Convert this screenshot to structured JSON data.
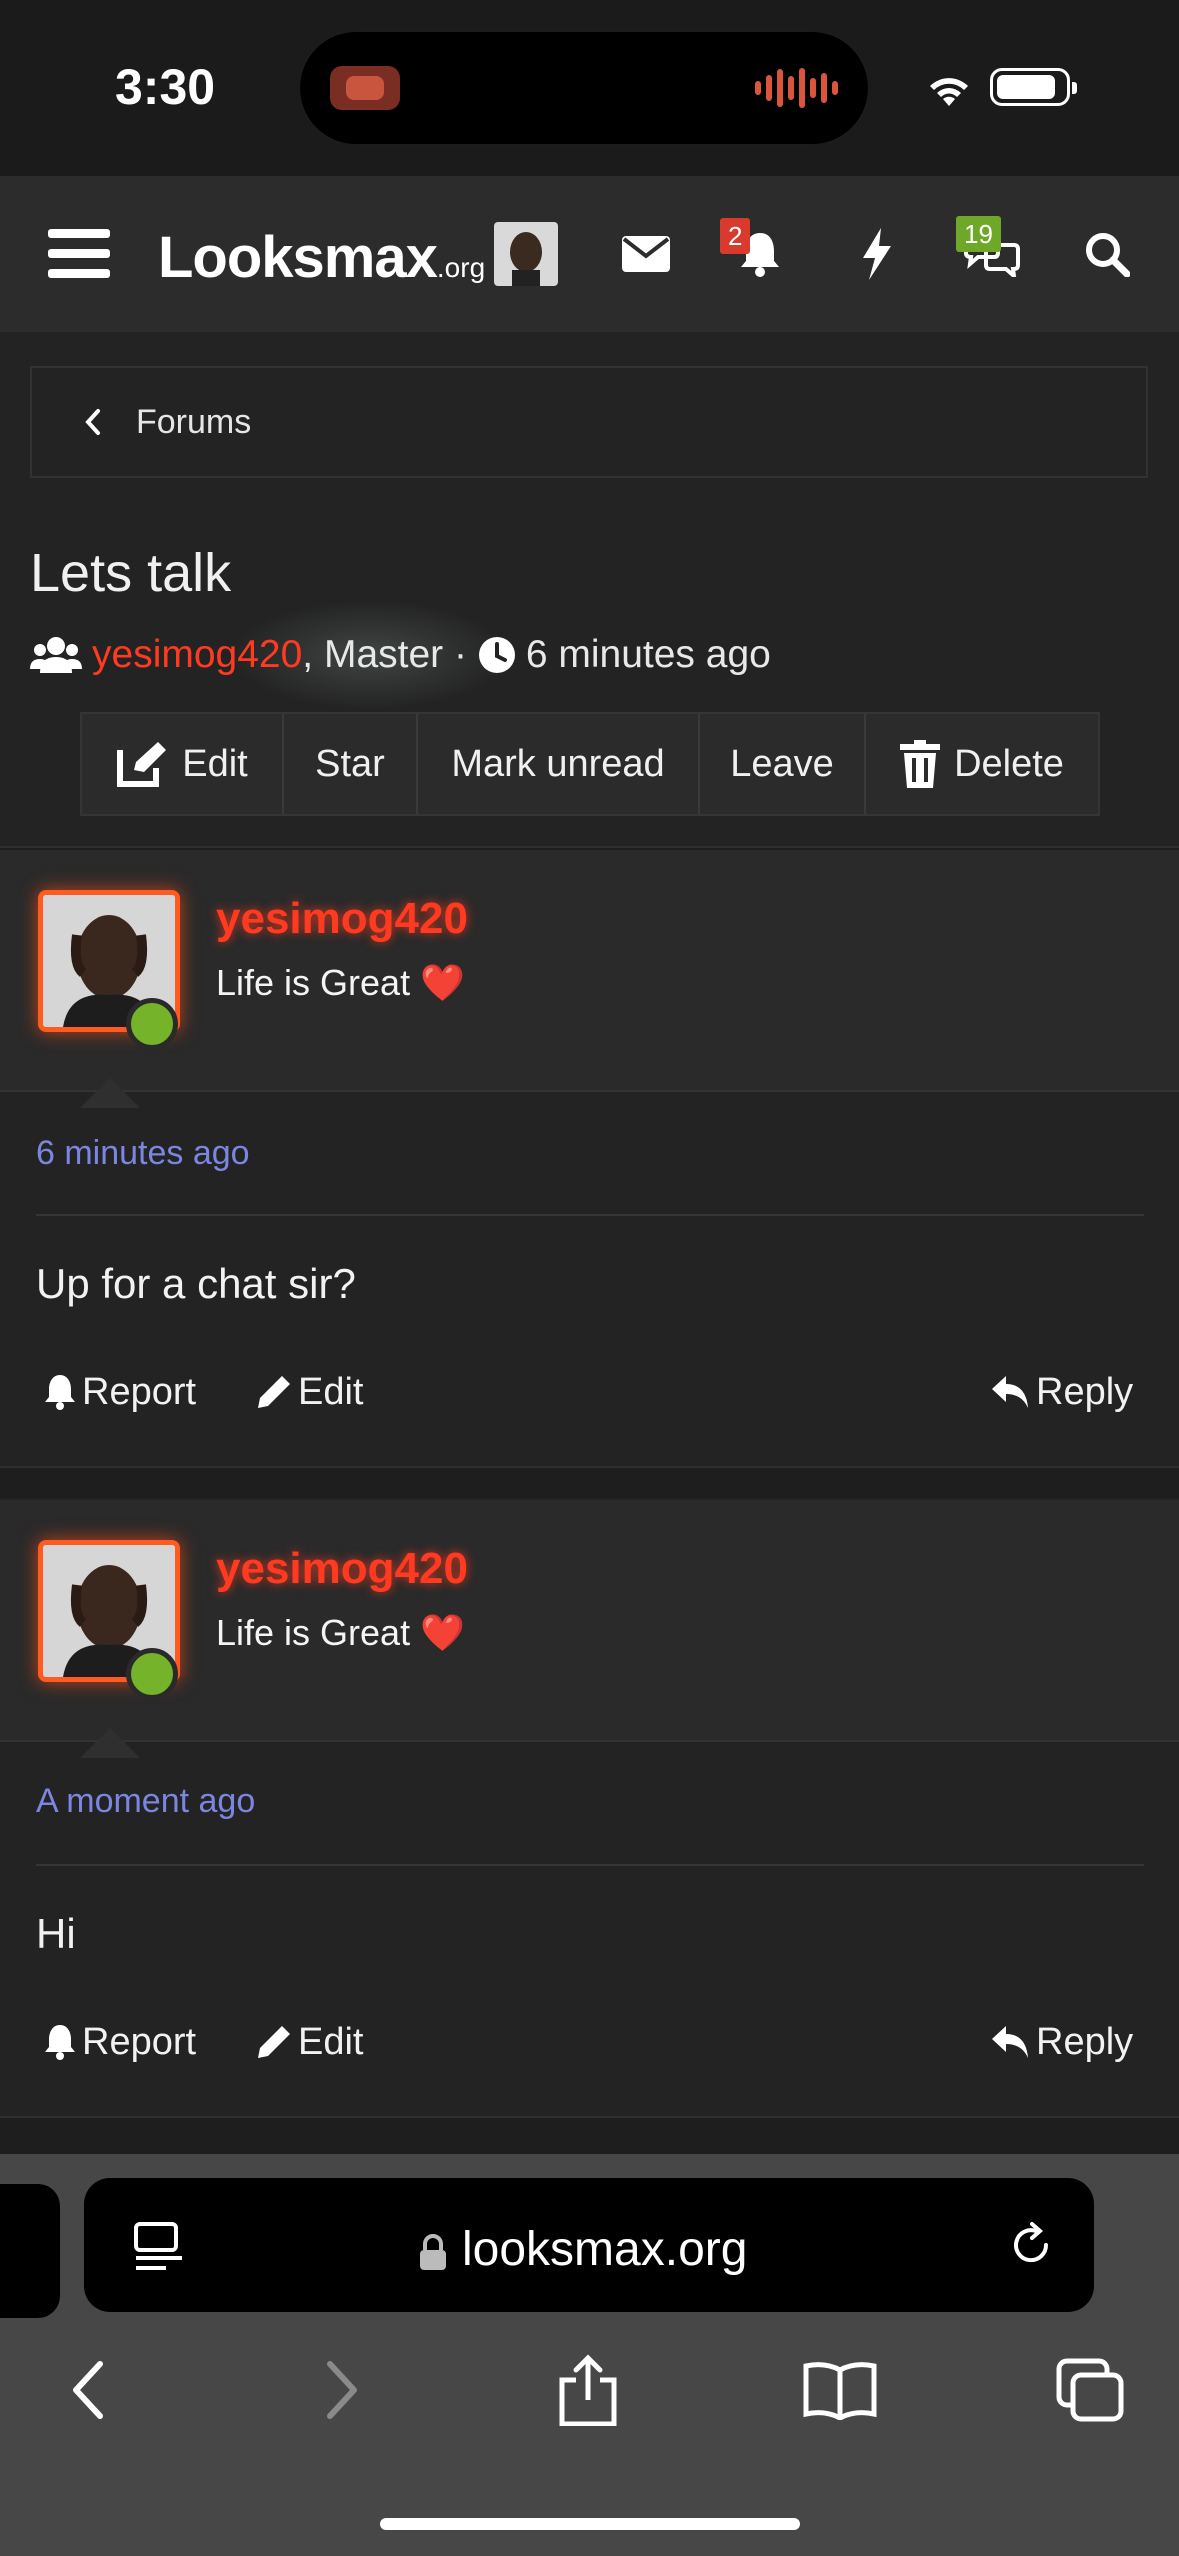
{
  "status_bar": {
    "time": "3:30"
  },
  "navbar": {
    "logo_main": "Looksmax",
    "logo_suffix": ".org",
    "notifications_badge": "2",
    "conversations_badge": "19"
  },
  "breadcrumb": {
    "label": "Forums"
  },
  "thread": {
    "title": "Lets talk",
    "participant_1": "yesimog420",
    "participant_sep": ", ",
    "participant_2": "Master",
    "dot": " · ",
    "time": "6 minutes ago"
  },
  "actions": {
    "edit": "Edit",
    "star": "Star",
    "mark_unread": "Mark unread",
    "leave": "Leave",
    "delete": "Delete"
  },
  "posts": [
    {
      "username": "yesimog420",
      "user_title": "Life is Great",
      "heart": "❤️",
      "time": "6 minutes ago",
      "body": "Up for a chat sir?",
      "report": "Report",
      "edit": "Edit",
      "reply": "Reply"
    },
    {
      "username": "yesimog420",
      "user_title": "Life is Great",
      "heart": "❤️",
      "time": "A moment ago",
      "body": "Hi",
      "report": "Report",
      "edit": "Edit",
      "reply": "Reply"
    }
  ],
  "safari": {
    "url": "looksmax.org"
  },
  "colors": {
    "accent_red": "#ff3a20",
    "timestamp": "#7b86e0",
    "online": "#74b32a",
    "badge_red": "#d83a2e",
    "badge_green": "#6fa829"
  }
}
